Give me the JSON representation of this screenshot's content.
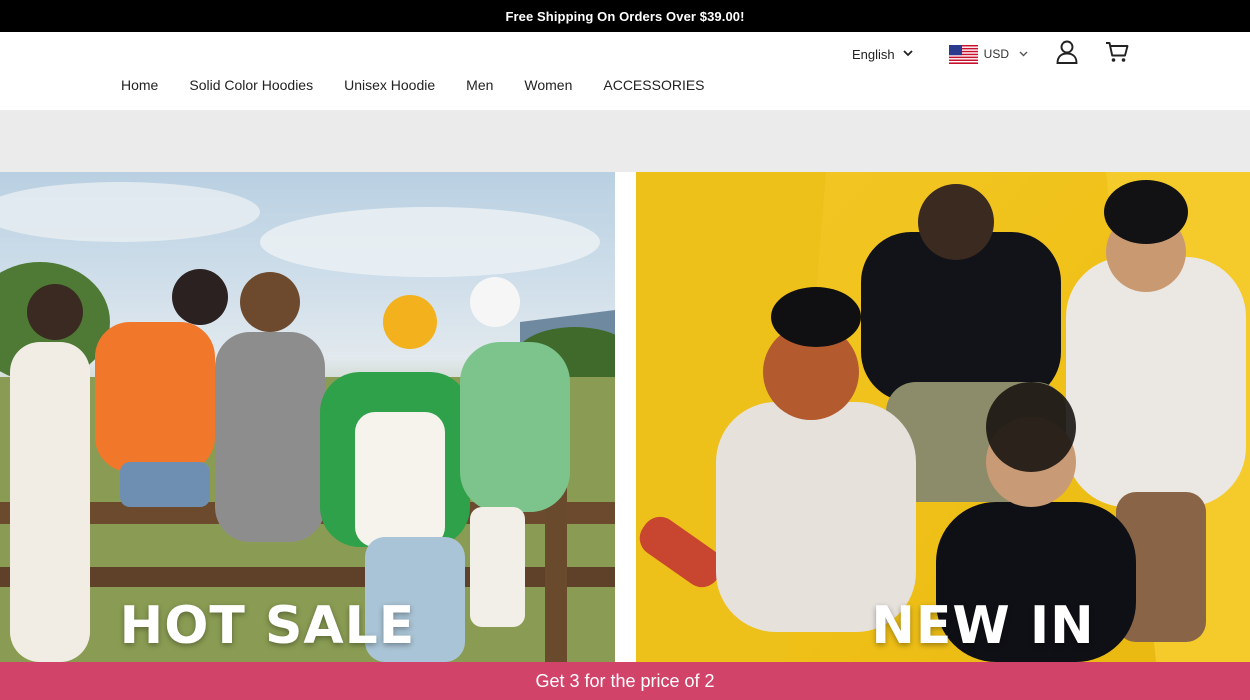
{
  "announcement": "Free Shipping On Orders Over $39.00!",
  "header": {
    "language": "English",
    "currency": "USD",
    "nav": [
      {
        "label": "Home"
      },
      {
        "label": "Solid Color Hoodies"
      },
      {
        "label": "Unisex Hoodie"
      },
      {
        "label": "Men"
      },
      {
        "label": "Women"
      },
      {
        "label": "ACCESSORIES"
      }
    ]
  },
  "banners": [
    {
      "title": "HOT SALE"
    },
    {
      "title": "NEW IN"
    }
  ],
  "promo_bar": "Get 3 for the price of 2",
  "colors": {
    "announcement_bg": "#000000",
    "promo_bg": "#d2436a",
    "right_banner_bg": "#f0c21a"
  },
  "icons": [
    "chevron-down-icon",
    "us-flag-icon",
    "user-icon",
    "cart-icon"
  ]
}
